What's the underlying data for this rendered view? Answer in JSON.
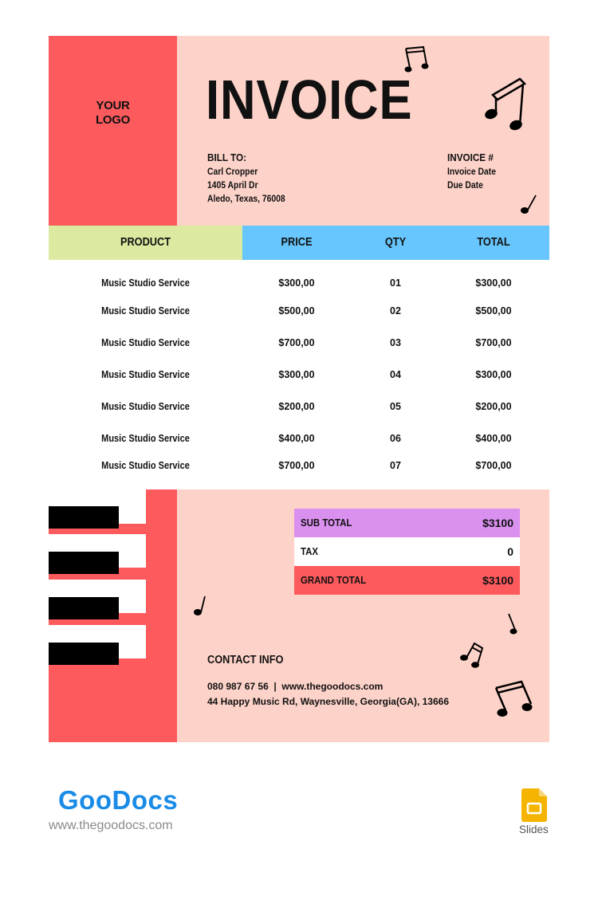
{
  "header": {
    "logo_line1": "YOUR",
    "logo_line2": "LOGO",
    "title": "INVOICE",
    "bill_to": {
      "label": "BILL TO:",
      "name": "Carl Cropper",
      "street": "1405 April Dr",
      "city": "Aledo, Texas, 76008"
    },
    "invoice_info": {
      "label": "INVOICE #",
      "date_label": "Invoice Date",
      "due_label": "Due Date"
    }
  },
  "table": {
    "columns": [
      "PRODUCT",
      "PRICE",
      "QTY",
      "TOTAL"
    ],
    "rows": [
      {
        "product": "Music Studio Service",
        "price": "$300,00",
        "qty": "01",
        "total": "$300,00"
      },
      {
        "product": "Music Studio Service",
        "price": "$500,00",
        "qty": "02",
        "total": "$500,00"
      },
      {
        "product": "Music Studio Service",
        "price": "$700,00",
        "qty": "03",
        "total": "$700,00"
      },
      {
        "product": "Music Studio Service",
        "price": "$300,00",
        "qty": "04",
        "total": "$300,00"
      },
      {
        "product": "Music Studio Service",
        "price": "$200,00",
        "qty": "05",
        "total": "$200,00"
      },
      {
        "product": "Music Studio Service",
        "price": "$400,00",
        "qty": "06",
        "total": "$400,00"
      },
      {
        "product": "Music Studio Service",
        "price": "$700,00",
        "qty": "07",
        "total": "$700,00"
      }
    ]
  },
  "summary": {
    "subtotal_label": "SUB TOTAL",
    "subtotal_value": "$3100",
    "tax_label": "TAX",
    "tax_value": "0",
    "grand_total_label": "GRAND TOTAL",
    "grand_total_value": "$3100"
  },
  "contact": {
    "title": "CONTACT INFO",
    "phone_web": "080 987 67 56  |  www.thegoodocs.com",
    "address": "44 Happy Music Rd, Waynesville, Georgia(GA), 13666"
  },
  "footer": {
    "brand": "GooDocs",
    "url": "www.thegoodocs.com",
    "app_label": "Slides"
  },
  "colors": {
    "red": "#fd5a5d",
    "pink": "#fdd2c8",
    "green": "#dbeaa0",
    "blue": "#66c6fd",
    "purple": "#da90ef",
    "brand_blue": "#1a8be6",
    "slides_yellow": "#f4b400"
  }
}
